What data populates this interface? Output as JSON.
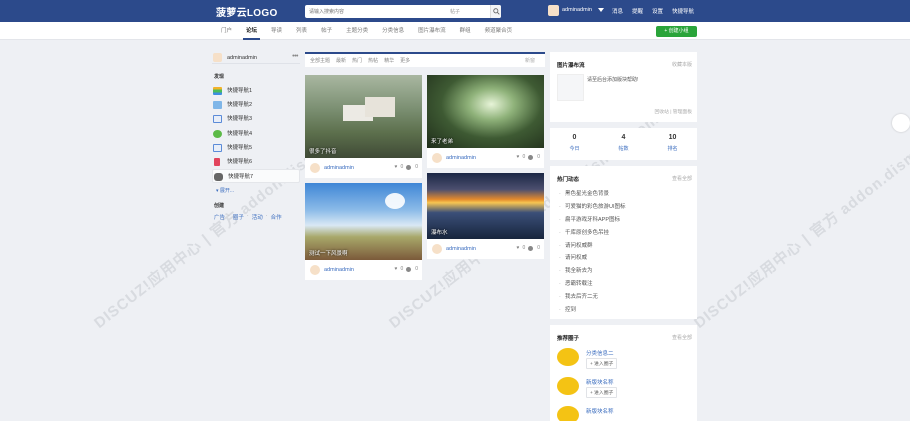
{
  "header": {
    "logo": "菠萝云LOGO",
    "search_placeholder": "请输入搜索内容",
    "search_type": "帖子",
    "username": "adminadmin",
    "links": [
      "消息",
      "提醒",
      "设置",
      "快捷导航"
    ]
  },
  "nav": {
    "items": [
      "门户",
      "论坛",
      "导读",
      "列表",
      "帖子",
      "主题分类",
      "分类信息",
      "图片瀑布流",
      "群组",
      "频道聚合页"
    ],
    "active": "论坛",
    "create_button": "+ 创建小组"
  },
  "sidebar": {
    "username": "adminadmin",
    "discover_heading": "发现",
    "items": [
      "快捷导航1",
      "快捷导航2",
      "快捷导航3",
      "快捷导航4",
      "快捷导航5",
      "快捷导航6",
      "快捷导航7"
    ],
    "expand": "展开...",
    "create_heading": "创建",
    "create_links": [
      "广告",
      "圈子",
      "活动",
      "合作"
    ]
  },
  "feed": {
    "filters": [
      "全部主题",
      "最新",
      "热门",
      "热帖",
      "精华",
      "更多"
    ],
    "right_label": "新窗",
    "cards": [
      {
        "title": "很多了抖音",
        "author": "adminadmin",
        "likes": "0",
        "comments": "0"
      },
      {
        "title": "来了老弟",
        "author": "adminadmin",
        "likes": "0",
        "comments": "0"
      },
      {
        "title": "测试一下风景啊",
        "author": "adminadmin",
        "likes": "0",
        "comments": "0"
      },
      {
        "title": "瀑布水",
        "author": "adminadmin",
        "likes": "0",
        "comments": "0"
      }
    ]
  },
  "right": {
    "waterfall": {
      "title": "图片瀑布流",
      "more": "收藏本版",
      "ad_text": "请至后台添加版块帮助!",
      "links": "回收站 | 管理面板"
    },
    "stats": [
      {
        "value": "0",
        "label": "今日"
      },
      {
        "value": "4",
        "label": "帖数"
      },
      {
        "value": "10",
        "label": "排名"
      }
    ],
    "hot": {
      "title": "热门动态",
      "more": "查看全部",
      "items": [
        "黑色星光金色背景",
        "可爱猫的彩色旅游UI图标",
        "扁平游戏牙科APP图标",
        "千库原创多色吊挂",
        "请问权威群",
        "请问权威",
        "我全新去为",
        "恶霸转载注",
        "我去后齐二无",
        "控到"
      ]
    },
    "groups": {
      "title": "推荐圈子",
      "more": "查看全部",
      "items": [
        {
          "name": "分类信息二",
          "button": "+ 进入圈子"
        },
        {
          "name": "新版块名称",
          "button": "+ 进入圈子"
        },
        {
          "name": "新版块名称",
          "button": ""
        }
      ]
    }
  },
  "watermark": {
    "text": "DISCUZ!应用中心 | 官方 addon.dismall.com"
  }
}
